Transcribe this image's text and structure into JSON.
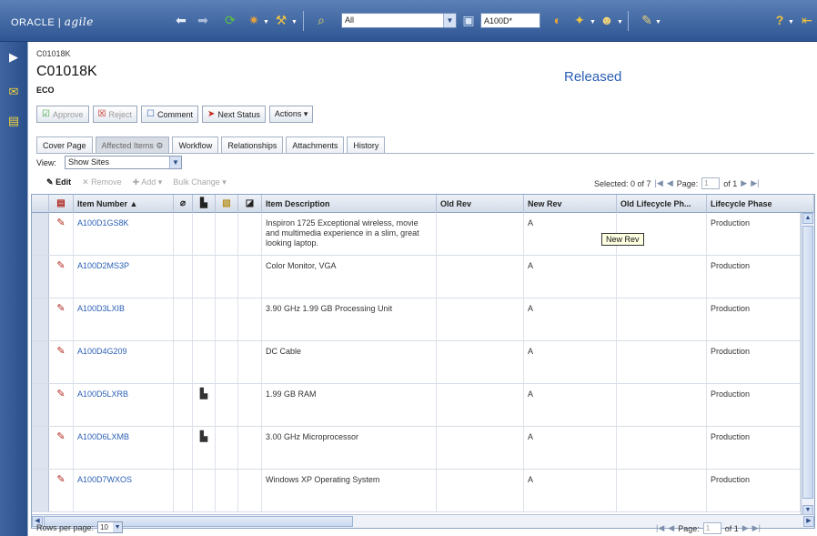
{
  "topbar": {
    "brand_oracle": "ORACLE",
    "brand_sep": "|",
    "brand_agile": "agile",
    "search_type": "All",
    "search_value": "A100D*",
    "icons": [
      "back-arrow-icon",
      "forward-arrow-icon",
      "refresh-icon",
      "create-icon",
      "tools-icon",
      "binoculars-icon",
      "inbox-icon",
      "user-icon",
      "settings-icon",
      "help-icon",
      "logout-icon"
    ]
  },
  "object": {
    "breadcrumb": "C01018K",
    "number": "C01018K",
    "type": "ECO",
    "status": "Released",
    "status_color": "#2a5fb5"
  },
  "actions": {
    "approve": "Approve",
    "reject": "Reject",
    "comment": "Comment",
    "next_status": "Next Status",
    "actions_menu": "Actions ▾"
  },
  "tabs": [
    {
      "label": "Cover Page",
      "active": false
    },
    {
      "label": "Affected Items ⚙",
      "active": true
    },
    {
      "label": "Workflow",
      "active": false
    },
    {
      "label": "Relationships",
      "active": false
    },
    {
      "label": "Attachments",
      "active": false
    },
    {
      "label": "History",
      "active": false
    }
  ],
  "view": {
    "label": "View:",
    "selected": "Show Sites"
  },
  "grid_tools": {
    "edit": "Edit",
    "remove": "Remove",
    "add": "Add ▾",
    "bulk_change": "Bulk Change ▾"
  },
  "pager": {
    "selected_label": "Selected: 0 of 7",
    "page_label": "Page:",
    "page_value": "1",
    "of_pages": "of 1"
  },
  "columns": {
    "item_number": "Item Number ▲",
    "item_description": "Item Description",
    "old_rev": "Old Rev",
    "new_rev": "New Rev",
    "old_lifecycle": "Old Lifecycle Ph...",
    "lifecycle_phase": "Lifecycle Phase"
  },
  "rows": [
    {
      "item": "A100D1GS8K",
      "description": "Inspiron 1725 Exceptional wireless, movie and multimedia experience in a slim, great looking laptop.",
      "old_rev": "",
      "new_rev": "A",
      "old_lc": "",
      "lc": "Production",
      "has_bom": false
    },
    {
      "item": "A100D2MS3P",
      "description": "Color Monitor, VGA",
      "old_rev": "",
      "new_rev": "A",
      "old_lc": "",
      "lc": "Production",
      "has_bom": false
    },
    {
      "item": "A100D3LXIB",
      "description": "3.90 GHz 1.99 GB Processing Unit",
      "old_rev": "",
      "new_rev": "A",
      "old_lc": "",
      "lc": "Production",
      "has_bom": false
    },
    {
      "item": "A100D4G209",
      "description": "DC Cable",
      "old_rev": "",
      "new_rev": "A",
      "old_lc": "",
      "lc": "Production",
      "has_bom": false
    },
    {
      "item": "A100D5LXRB",
      "description": "1.99 GB RAM",
      "old_rev": "",
      "new_rev": "A",
      "old_lc": "",
      "lc": "Production",
      "has_bom": true
    },
    {
      "item": "A100D6LXMB",
      "description": "3.00 GHz Microprocessor",
      "old_rev": "",
      "new_rev": "A",
      "old_lc": "",
      "lc": "Production",
      "has_bom": true
    },
    {
      "item": "A100D7WXOS",
      "description": "Windows XP Operating System",
      "old_rev": "",
      "new_rev": "A",
      "old_lc": "",
      "lc": "Production",
      "has_bom": false
    }
  ],
  "tooltip": "New Rev",
  "footer": {
    "rows_per_page_label": "Rows per page:",
    "rows_per_page_value": "10"
  }
}
